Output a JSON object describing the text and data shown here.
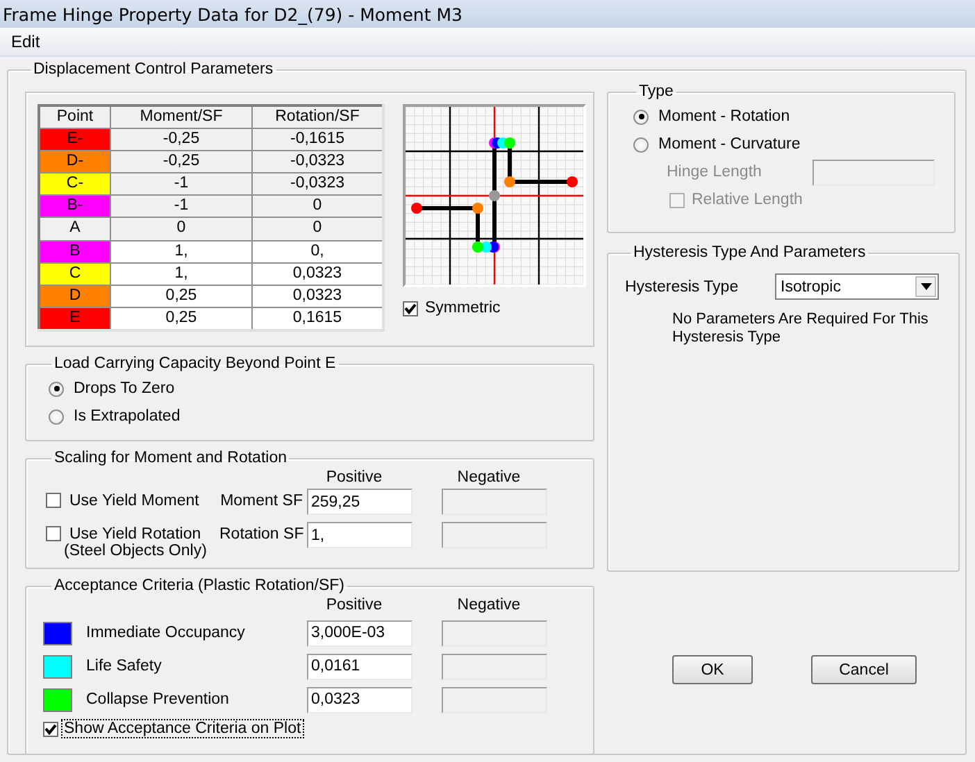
{
  "window": {
    "title": "Frame Hinge Property Data for D2_(79) - Moment M3"
  },
  "menu": [
    "Edit"
  ],
  "displacement": {
    "title": "Displacement Control Parameters",
    "table": {
      "columns": [
        "Point",
        "Moment/SF",
        "Rotation/SF"
      ],
      "rows": [
        {
          "point": "E-",
          "color": "#ff0000",
          "moment": "-0,25",
          "rotation": "-0,1615",
          "editable": false
        },
        {
          "point": "D-",
          "color": "#ff8000",
          "moment": "-0,25",
          "rotation": "-0,0323",
          "editable": false
        },
        {
          "point": "C-",
          "color": "#ffff00",
          "moment": "-1",
          "rotation": "-0,0323",
          "editable": false
        },
        {
          "point": "B-",
          "color": "#ff00ff",
          "moment": "-1",
          "rotation": "0",
          "editable": false
        },
        {
          "point": "A",
          "color": "#f0f0f0",
          "moment": "0",
          "rotation": "0",
          "editable": false
        },
        {
          "point": "B",
          "color": "#ff00ff",
          "moment": "1,",
          "rotation": "0,",
          "editable": true
        },
        {
          "point": "C",
          "color": "#ffff00",
          "moment": "1,",
          "rotation": "0,0323",
          "editable": true
        },
        {
          "point": "D",
          "color": "#ff8000",
          "moment": "0,25",
          "rotation": "0,0323",
          "editable": true
        },
        {
          "point": "E",
          "color": "#ff0000",
          "moment": "0,25",
          "rotation": "0,1615",
          "editable": true
        }
      ]
    },
    "symmetric": {
      "label": "Symmetric",
      "checked": true
    }
  },
  "load_capacity": {
    "title": "Load Carrying Capacity Beyond Point E",
    "options": [
      {
        "label": "Drops To Zero",
        "selected": true
      },
      {
        "label": "Is Extrapolated",
        "selected": false
      }
    ]
  },
  "scaling": {
    "title": "Scaling for Moment and Rotation",
    "positive_heading": "Positive",
    "negative_heading": "Negative",
    "rows": [
      {
        "checkbox_label": "Use Yield Moment",
        "checked": false,
        "field_label": "Moment SF",
        "positive": "259,25"
      },
      {
        "checkbox_label": "Use Yield Rotation",
        "note": "(Steel Objects Only)",
        "checked": false,
        "field_label": "Rotation SF",
        "positive": "1,"
      }
    ]
  },
  "acceptance": {
    "title": "Acceptance Criteria (Plastic Rotation/SF)",
    "positive_heading": "Positive",
    "negative_heading": "Negative",
    "rows": [
      {
        "label": "Immediate Occupancy",
        "color": "#0000ff",
        "positive": "3,000E-03"
      },
      {
        "label": "Life Safety",
        "color": "#00ffff",
        "positive": "0,0161"
      },
      {
        "label": "Collapse Prevention",
        "color": "#00ff00",
        "positive": "0,0323"
      }
    ],
    "show_on_plot": {
      "label": "Show Acceptance Criteria on Plot",
      "checked": true
    }
  },
  "type": {
    "title": "Type",
    "options": [
      {
        "label": "Moment - Rotation",
        "selected": true
      },
      {
        "label": "Moment - Curvature",
        "selected": false
      }
    ],
    "hinge_length": {
      "label": "Hinge Length",
      "disabled": true
    },
    "relative_length": {
      "label": "Relative Length",
      "checked": false,
      "disabled": true
    }
  },
  "hysteresis": {
    "title": "Hysteresis Type And Parameters",
    "label": "Hysteresis Type",
    "value": "Isotropic",
    "note": "No Parameters Are Required For This Hysteresis Type"
  },
  "buttons": [
    {
      "label": "OK"
    },
    {
      "label": "Cancel"
    }
  ]
}
